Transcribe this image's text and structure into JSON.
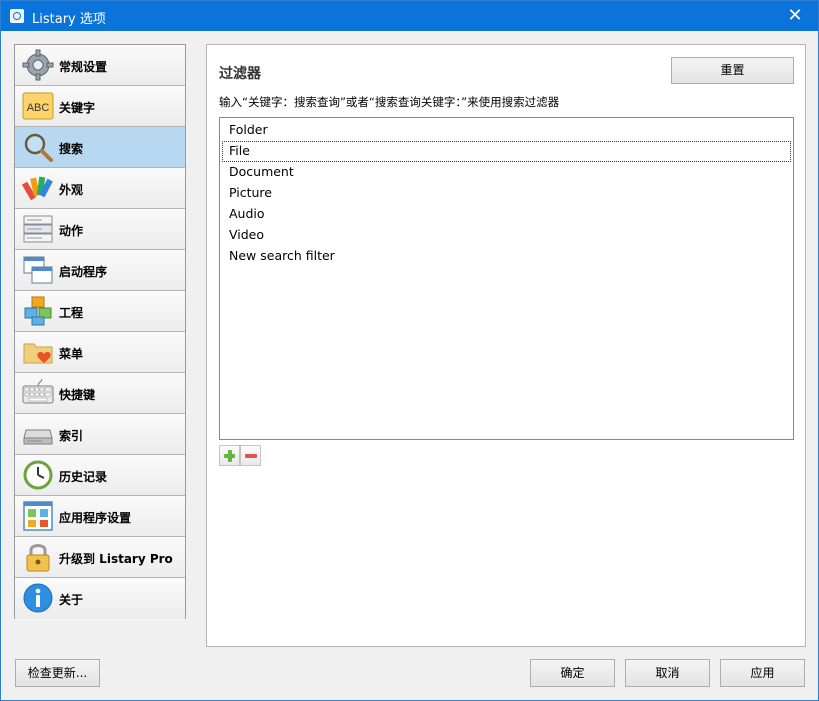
{
  "window": {
    "title": "Listary 选项",
    "close_glyph": "✕"
  },
  "sidebar": {
    "items": [
      {
        "label": "常规设置",
        "icon": "gear-icon"
      },
      {
        "label": "关键字",
        "icon": "abc-icon"
      },
      {
        "label": "搜索",
        "icon": "magnifier-icon",
        "selected": true
      },
      {
        "label": "外观",
        "icon": "palette-icon"
      },
      {
        "label": "动作",
        "icon": "action-list-icon"
      },
      {
        "label": "启动程序",
        "icon": "launch-windows-icon"
      },
      {
        "label": "工程",
        "icon": "boxes-icon"
      },
      {
        "label": "菜单",
        "icon": "folder-heart-icon"
      },
      {
        "label": "快捷键",
        "icon": "keyboard-icon"
      },
      {
        "label": "索引",
        "icon": "drive-icon"
      },
      {
        "label": "历史记录",
        "icon": "clock-icon"
      },
      {
        "label": "应用程序设置",
        "icon": "app-grid-icon"
      },
      {
        "label": "升级到 Listary Pro",
        "icon": "lock-icon"
      },
      {
        "label": "关于",
        "icon": "info-icon"
      }
    ]
  },
  "panel": {
    "heading": "过滤器",
    "reset_label": "重置",
    "description": "输入“关键字：搜索查询”或者“搜索查询关键字：”来使用搜索过滤器",
    "filters": [
      "Folder",
      "File",
      "Document",
      "Picture",
      "Audio",
      "Video",
      "New search filter"
    ],
    "focused_filter": "File"
  },
  "footer": {
    "check_update_label": "检查更新...",
    "ok_label": "确定",
    "cancel_label": "取消",
    "apply_label": "应用"
  },
  "colors": {
    "titlebar": "#0a74da",
    "selected_item": "#b8d8f2",
    "add_green": "#5fb83a",
    "remove_red": "#e0554a"
  }
}
